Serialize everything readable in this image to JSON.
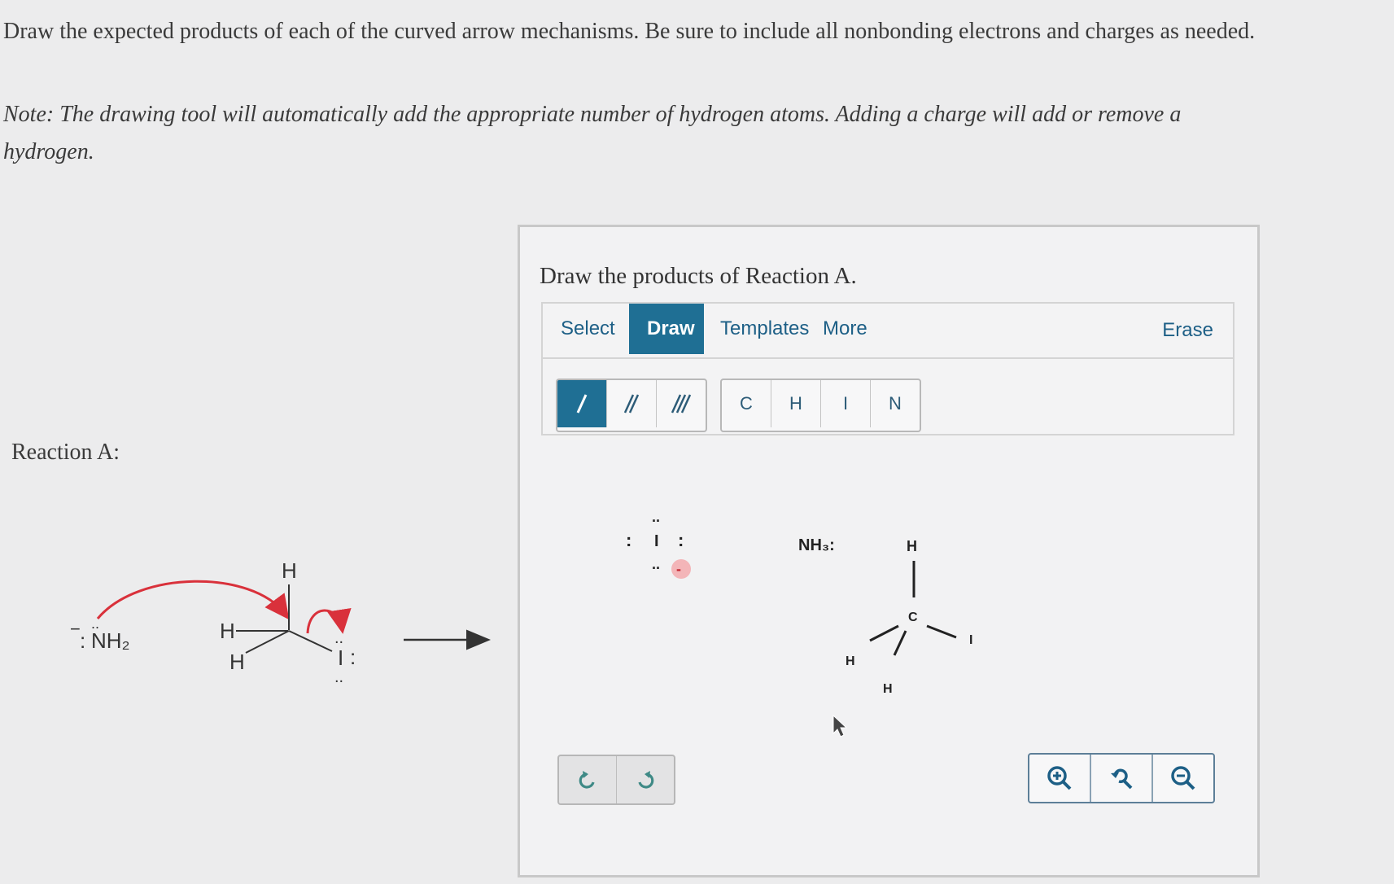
{
  "instructions": {
    "main": "Draw the expected products of each of the curved arrow mechanisms. Be sure to include all nonbonding electrons and charges as needed.",
    "note": "Note: The drawing tool will automatically add the appropriate number of hydrogen atoms. Adding a charge will add or remove a hydrogen."
  },
  "reaction": {
    "label": "Reaction A:",
    "nucleophile": "NH₂",
    "nucleophile_charge": "−",
    "substrate_atoms": {
      "h_top": "H",
      "h_left": "H",
      "h_lower": "H",
      "leaving_group": "I"
    }
  },
  "panel": {
    "title": "Draw the products of Reaction A.",
    "tabs": [
      "Select",
      "Draw",
      "Templates",
      "More"
    ],
    "active_tab": "Draw",
    "erase_label": "Erase",
    "bond_tools": [
      "single-bond",
      "double-bond",
      "triple-bond"
    ],
    "element_tools": [
      "C",
      "H",
      "I",
      "N"
    ]
  },
  "canvas": {
    "iodide_symbol": "I",
    "iodide_charge": "-",
    "ammonia_label": "NH₃:",
    "methyl_atoms": {
      "top": "H",
      "center": "C",
      "left": "H",
      "bottom": "H",
      "right": "I"
    }
  },
  "colors": {
    "accent": "#1f6f94",
    "arrow": "#d9313b",
    "charge_circle": "#f3b5b8"
  }
}
